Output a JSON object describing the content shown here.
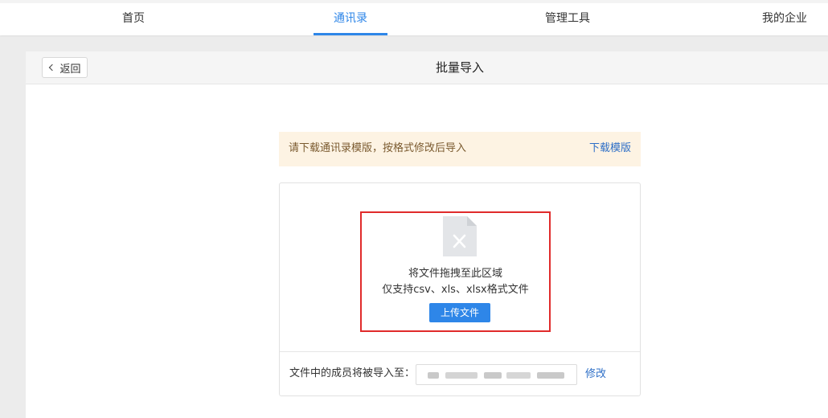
{
  "nav": {
    "tabs": [
      {
        "label": "首页"
      },
      {
        "label": "通讯录"
      },
      {
        "label": "管理工具"
      },
      {
        "label": "我的企业"
      }
    ],
    "active_color": "#2e86e8"
  },
  "header": {
    "back_label": "返回",
    "title": "批量导入"
  },
  "notice": {
    "text": "请下载通讯录模版，按格式修改后导入",
    "link": "下载模版"
  },
  "upload": {
    "drop_line1": "将文件拖拽至此区域",
    "drop_line2": "仅支持csv、xls、xlsx格式文件",
    "button_label": "上传文件",
    "highlight_color": "#e02b2b"
  },
  "import_target": {
    "label": "文件中的成员将被导入至：",
    "modify_link": "修改"
  }
}
